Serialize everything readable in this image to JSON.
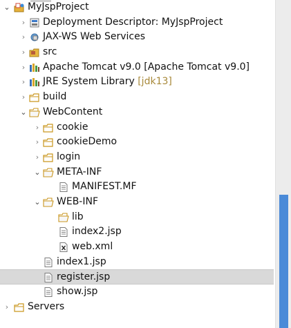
{
  "project_explorer": {
    "items": [
      {
        "label": "MyJspProject",
        "icon": "project-icon",
        "expand": "open"
      },
      {
        "label": "Deployment Descriptor: MyJspProject",
        "icon": "deployment-descriptor-icon",
        "expand": "closed"
      },
      {
        "label": "JAX-WS Web Services",
        "icon": "web-services-icon",
        "expand": "closed"
      },
      {
        "label": "src",
        "icon": "source-folder-icon",
        "expand": "closed"
      },
      {
        "label": "Apache Tomcat v9.0 [Apache Tomcat v9.0]",
        "icon": "library-icon",
        "expand": "closed"
      },
      {
        "label": "JRE System Library",
        "decoration": "[jdk13]",
        "icon": "library-icon",
        "expand": "closed"
      },
      {
        "label": "build",
        "icon": "folder-icon",
        "expand": "closed"
      },
      {
        "label": "WebContent",
        "icon": "folder-open-icon",
        "expand": "open"
      },
      {
        "label": "cookie",
        "icon": "folder-icon",
        "expand": "closed"
      },
      {
        "label": "cookieDemo",
        "icon": "folder-icon",
        "expand": "closed"
      },
      {
        "label": "login",
        "icon": "folder-icon",
        "expand": "closed"
      },
      {
        "label": "META-INF",
        "icon": "folder-open-icon",
        "expand": "open"
      },
      {
        "label": "MANIFEST.MF",
        "icon": "manifest-file-icon",
        "expand": "none"
      },
      {
        "label": "WEB-INF",
        "icon": "folder-open-icon",
        "expand": "open"
      },
      {
        "label": "lib",
        "icon": "folder-icon",
        "expand": "none"
      },
      {
        "label": "index2.jsp",
        "icon": "jsp-file-icon",
        "expand": "none"
      },
      {
        "label": "web.xml",
        "icon": "xml-file-icon",
        "expand": "none"
      },
      {
        "label": "index1.jsp",
        "icon": "jsp-file-icon",
        "expand": "none"
      },
      {
        "label": "register.jsp",
        "icon": "jsp-file-icon",
        "expand": "none",
        "selected": true
      },
      {
        "label": "show.jsp",
        "icon": "jsp-file-icon",
        "expand": "none"
      },
      {
        "label": "Servers",
        "icon": "folder-icon",
        "expand": "closed"
      }
    ]
  },
  "colors": {
    "selection": "#d9d9d9",
    "scrollbar_thumb": "#4a8ad8",
    "folder": "#e7b83f",
    "decoration": "#a8893a"
  }
}
